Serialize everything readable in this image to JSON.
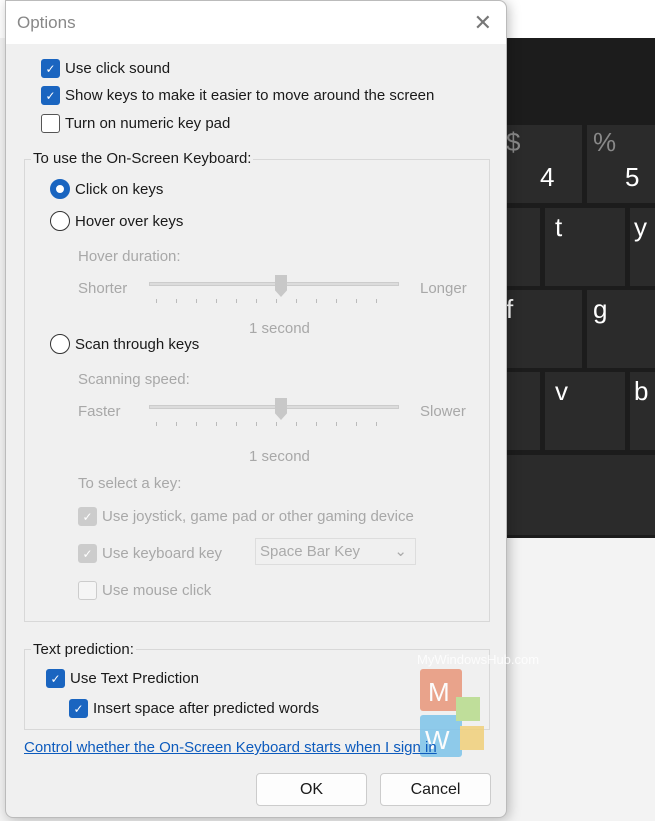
{
  "dialog": {
    "title": "Options",
    "close_icon": "close-icon"
  },
  "general": [
    {
      "label": "Use click sound",
      "checked": true
    },
    {
      "label": "Show keys to make it easier to move around the screen",
      "checked": true
    },
    {
      "label": "Turn on numeric key pad",
      "checked": false
    }
  ],
  "mode": {
    "legend": "To use the On-Screen Keyboard:",
    "click": "Click on keys",
    "click_selected": true,
    "hover": "Hover over keys",
    "hover_duration": "Hover duration:",
    "shorter": "Shorter",
    "longer": "Longer",
    "hover_value": "1 second",
    "scan": "Scan through keys",
    "scan_speed": "Scanning speed:",
    "faster": "Faster",
    "slower": "Slower",
    "scan_value": "1 second",
    "select_key": "To select a key:",
    "joystick": "Use joystick, game pad or other gaming device",
    "keyboard_key": "Use keyboard key",
    "keyboard_key_value": "Space Bar Key",
    "mouse_click": "Use mouse click"
  },
  "prediction": {
    "legend": "Text prediction:",
    "use": "Use Text Prediction",
    "space": "Insert space after predicted words"
  },
  "link": "Control whether the On-Screen Keyboard starts when I sign in",
  "buttons": {
    "ok": "OK",
    "cancel": "Cancel"
  },
  "keyboard": {
    "keys": [
      {
        "shift": "$",
        "main": "4"
      },
      {
        "shift": "%",
        "main": "5"
      },
      {
        "main": "t"
      },
      {
        "main": "y"
      },
      {
        "main": "f"
      },
      {
        "main": "g"
      },
      {
        "main": "v"
      },
      {
        "main": "b"
      }
    ]
  },
  "watermark": "MyWindowsHub.com"
}
